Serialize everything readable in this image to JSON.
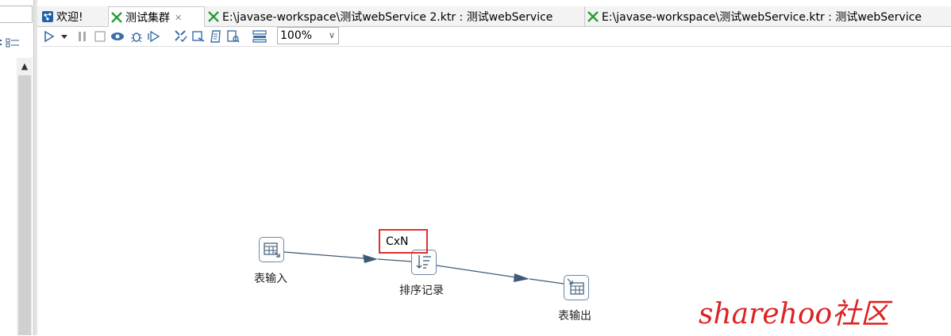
{
  "tabs": {
    "welcome": {
      "label": "欢迎!"
    },
    "cluster": {
      "label": "测试集群",
      "close": "✕"
    },
    "file2": {
      "label": "E:\\javase-workspace\\测试webService 2.ktr : 测试webService"
    },
    "file1": {
      "label": "E:\\javase-workspace\\测试webService.ktr : 测试webService"
    }
  },
  "toolbar": {
    "zoom": "100%",
    "icons": [
      "run-icon",
      "run-dropdown-icon",
      "pause-icon",
      "stop-icon",
      "preview-icon",
      "debug-icon",
      "replay-icon",
      "verify-icon",
      "impact-icon",
      "sql-icon",
      "explore-db-icon",
      "results-icon"
    ]
  },
  "canvas": {
    "steps": [
      {
        "id": "table-input",
        "label": "表输入"
      },
      {
        "id": "sort-rows",
        "label": "排序记录"
      },
      {
        "id": "table-output",
        "label": "表输出"
      }
    ],
    "cxn_label": "CxN"
  },
  "watermark": "sharehoo社区",
  "colors": {
    "highlight": "#e0302f",
    "watermark": "#dd2222",
    "hop": "#3d5a78",
    "step_border": "#6c8aa8"
  }
}
